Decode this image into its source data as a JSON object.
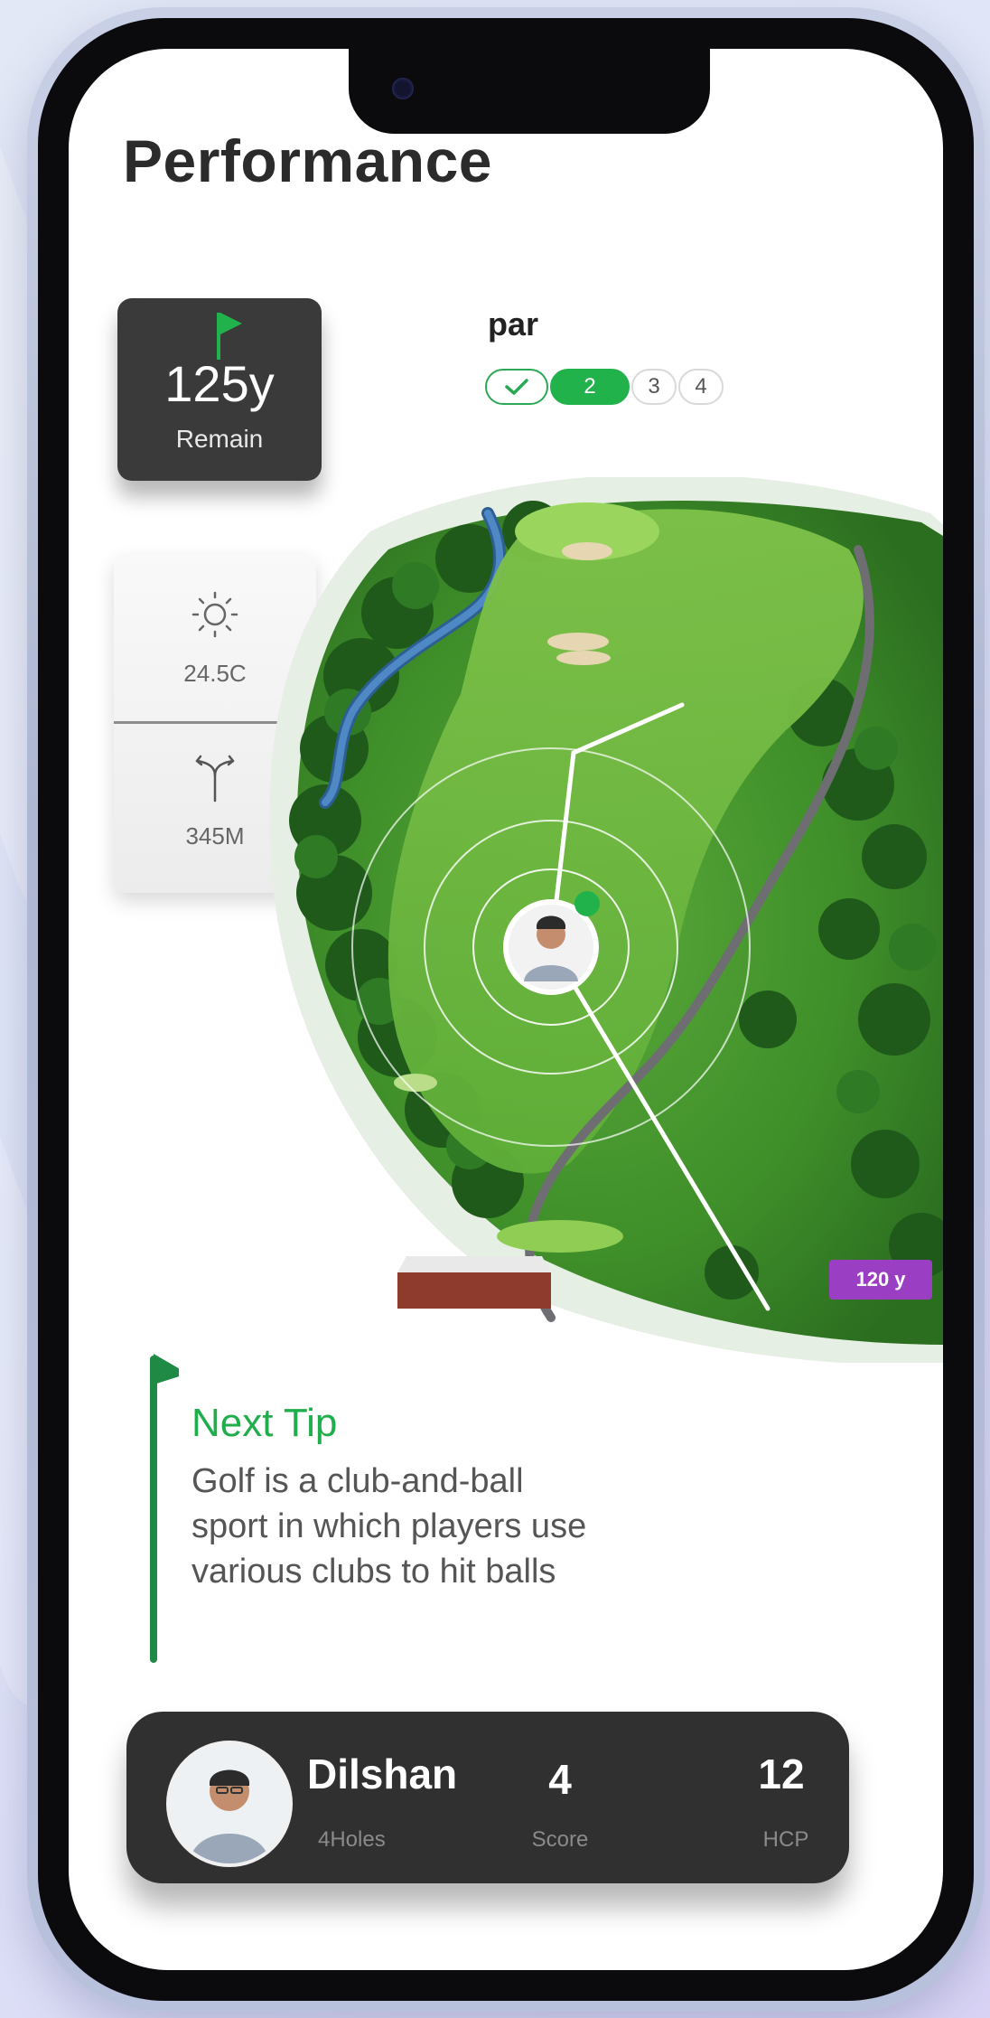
{
  "page": {
    "title": "Performance"
  },
  "remain": {
    "value": "125y",
    "label": "Remain"
  },
  "par": {
    "label": "par",
    "options": [
      "2",
      "3",
      "4"
    ],
    "selected": "2"
  },
  "conditions": {
    "temperature": "24.5C",
    "distance": "345M"
  },
  "course_map": {
    "distance_tag": "120 y"
  },
  "tip": {
    "title": "Next Tip",
    "body": "Golf is a club-and-ball sport in which players use various clubs to hit balls"
  },
  "player": {
    "name": "Dilshan",
    "holes": "4Holes",
    "score_value": "4",
    "score_label": "Score",
    "hcp_value": "12",
    "hcp_label": "HCP"
  },
  "colors": {
    "accent_green": "#22b24c",
    "card_dark": "#3a3a3a",
    "distance_tag": "#9a3fc4"
  }
}
